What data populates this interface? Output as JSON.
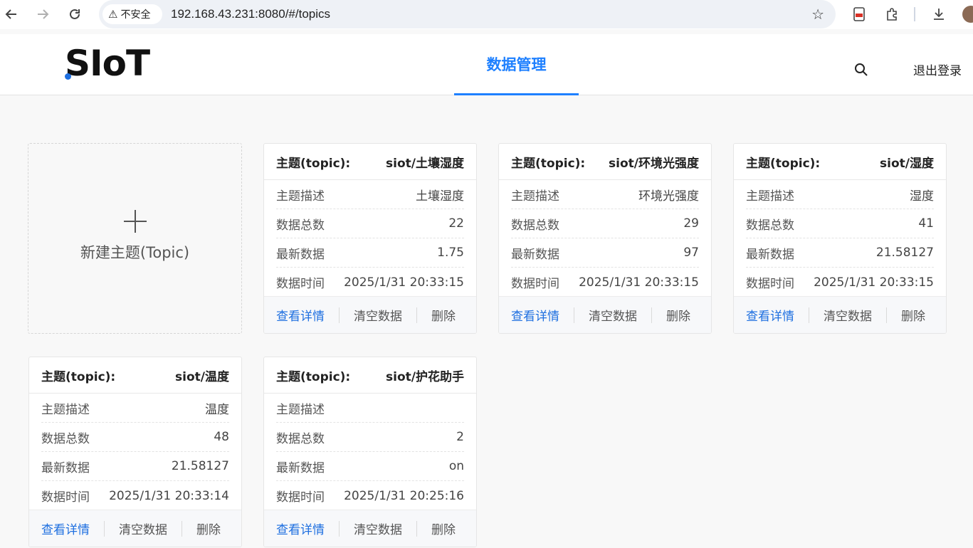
{
  "browser": {
    "security_label": "不安全",
    "url": "192.168.43.231:8080/#/topics"
  },
  "header": {
    "logo_text": "SIoT",
    "nav_tab": "数据管理",
    "logout": "退出登录"
  },
  "new_topic": {
    "label": "新建主题(Topic)"
  },
  "labels": {
    "topic": "主题(topic):",
    "desc": "主题描述",
    "count": "数据总数",
    "latest": "最新数据",
    "time": "数据时间",
    "view": "查看详情",
    "clear": "清空数据",
    "delete": "删除"
  },
  "cards": [
    {
      "name": "siot/土壤湿度",
      "desc": "土壤湿度",
      "count": "22",
      "latest": "1.75",
      "time": "2025/1/31 20:33:15"
    },
    {
      "name": "siot/环境光强度",
      "desc": "环境光强度",
      "count": "29",
      "latest": "97",
      "time": "2025/1/31 20:33:15"
    },
    {
      "name": "siot/湿度",
      "desc": "湿度",
      "count": "41",
      "latest": "21.58127",
      "time": "2025/1/31 20:33:15"
    },
    {
      "name": "siot/温度",
      "desc": "温度",
      "count": "48",
      "latest": "21.58127",
      "time": "2025/1/31 20:33:14"
    },
    {
      "name": "siot/护花助手",
      "desc": "",
      "count": "2",
      "latest": "on",
      "time": "2025/1/31 20:25:16"
    }
  ]
}
